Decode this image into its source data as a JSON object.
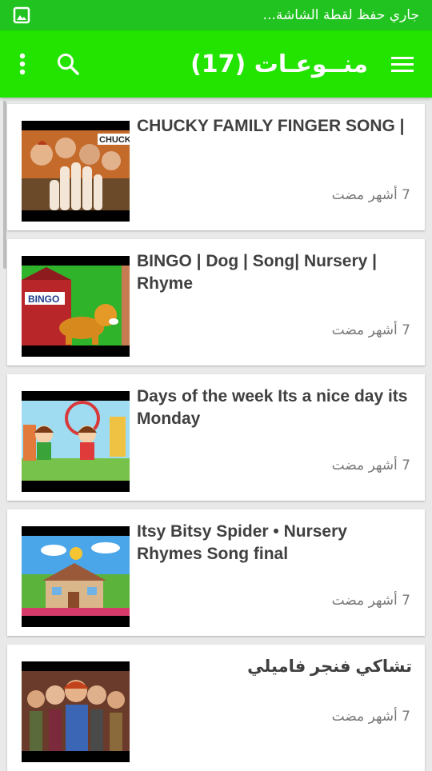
{
  "status_bar": {
    "text": "جاري حفظ لقطة الشاشة...",
    "icon": "image-icon"
  },
  "app_bar": {
    "title": "منــوعـات (17)",
    "menu_icon": "hamburger-menu-icon",
    "search_icon": "search-icon",
    "more_icon": "more-vertical-icon",
    "background_color": "#22e400"
  },
  "videos": [
    {
      "title": "CHUCKY FAMILY FINGER SONG |",
      "time": "7 أشهر مضت",
      "thumbnail": "chucky-family-thumbnail"
    },
    {
      "title": "BINGO | Dog | Song| Nursery | Rhyme",
      "time": "7 أشهر مضت",
      "thumbnail": "bingo-dog-thumbnail",
      "thumb_label": "BINGO"
    },
    {
      "title": "Days of the week Its a nice day its Monday",
      "time": "7 أشهر مضت",
      "thumbnail": "days-of-week-thumbnail"
    },
    {
      "title": "Itsy Bitsy Spider • Nursery Rhymes Song final",
      "time": "7 أشهر مضت",
      "thumbnail": "itsy-bitsy-thumbnail"
    },
    {
      "title": "تشاكي فنجر فاميلي",
      "time": "7 أشهر مضت",
      "thumbnail": "chucky-finger-family-thumbnail"
    }
  ]
}
